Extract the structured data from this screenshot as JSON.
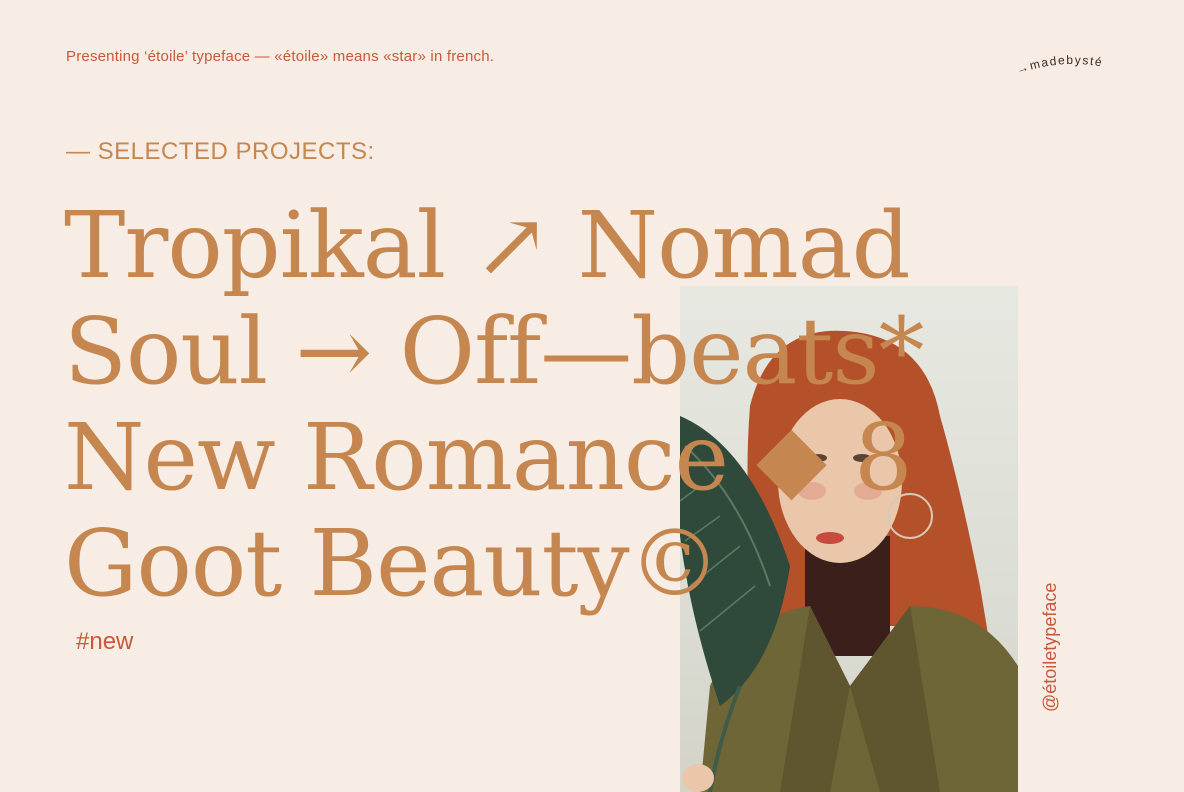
{
  "intro": "Presenting ‘étoile’ typeface —  «étoile» means «star» in french.",
  "brand": "→madebysté",
  "section_heading": "— SELECTED PROJECTS:",
  "lines": [
    "Tropikal ↗ Nomad",
    "Soul → Off—beats*",
    "New Romance ◆ 8",
    "Goot Beauty©"
  ],
  "tag": "#new",
  "handle": "@étoiletypeface",
  "colors": {
    "background": "#f8ede4",
    "headline": "#c5874f",
    "accent": "#c8583a"
  }
}
